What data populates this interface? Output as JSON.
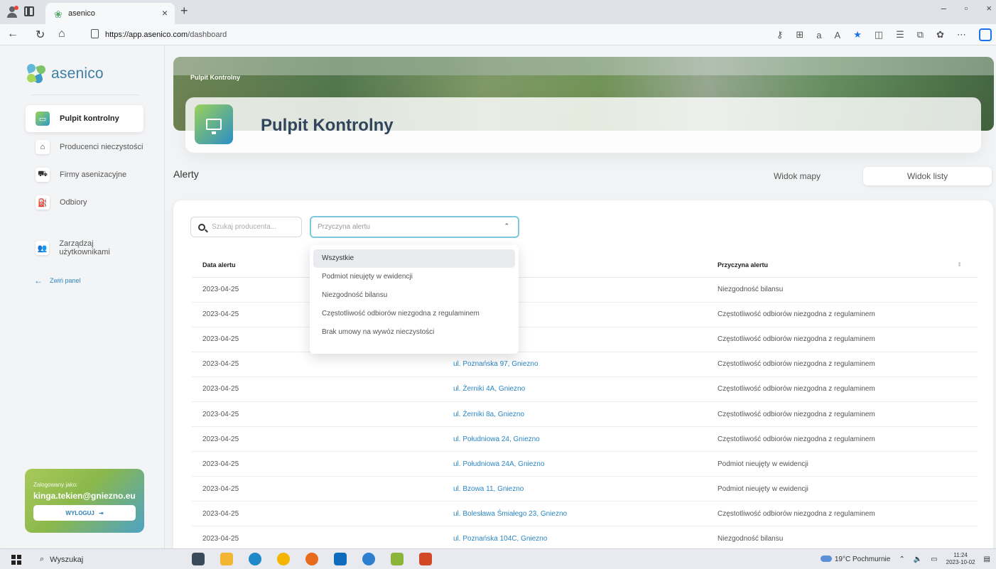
{
  "browser": {
    "tab_title": "asenico",
    "url_domain": "https://app.asenico.com",
    "url_path": "/dashboard"
  },
  "sidebar": {
    "brand": "asenico",
    "items": [
      {
        "label": "Pulpit kontrolny",
        "icon": "monitor-icon",
        "active": true
      },
      {
        "label": "Producenci nieczystości",
        "icon": "home-icon"
      },
      {
        "label": "Firmy asenizacyjne",
        "icon": "truck-icon"
      },
      {
        "label": "Odbiory",
        "icon": "tanker-icon"
      },
      {
        "label": "Zarządzaj użytkownikami",
        "icon": "users-icon"
      }
    ],
    "collapse_label": "Zwiń panel",
    "user": {
      "logged_label": "Zalogowany jako:",
      "email": "kinga.tekien@gniezno.eu",
      "logout_label": "WYLOGUJ"
    }
  },
  "header": {
    "breadcrumb": "Pulpit Kontrolny",
    "title": "Pulpit Kontrolny"
  },
  "alerts": {
    "section_title": "Alerty",
    "view_map": "Widok mapy",
    "view_list": "Widok listy",
    "search_placeholder": "Szukaj producenta...",
    "filter_placeholder": "Przyczyna alertu",
    "filter_options": [
      "Wszystkie",
      "Podmiot nieujęty w ewidencji",
      "Niezgodność bilansu",
      "Częstotliwość odbiorów niezgodna z regulaminem",
      "Brak umowy na wywóz nieczystości"
    ],
    "columns": [
      "Data alertu",
      "ości",
      "Przyczyna alertu"
    ],
    "rows": [
      {
        "date": "2023-04-25",
        "address": "zno",
        "reason": "Niezgodność bilansu"
      },
      {
        "date": "2023-04-25",
        "address": "iezno",
        "reason": "Częstotliwość odbiorów niezgodna z regulaminem"
      },
      {
        "date": "2023-04-25",
        "address": "A, Gniezno",
        "reason": "Częstotliwość odbiorów niezgodna z regulaminem"
      },
      {
        "date": "2023-04-25",
        "address": "ul. Poznańska 97, Gniezno",
        "reason": "Częstotliwość odbiorów niezgodna z regulaminem"
      },
      {
        "date": "2023-04-25",
        "address": "ul. Żerniki 4A, Gniezno",
        "reason": "Częstotliwość odbiorów niezgodna z regulaminem"
      },
      {
        "date": "2023-04-25",
        "address": "ul. Żerniki 8a, Gniezno",
        "reason": "Częstotliwość odbiorów niezgodna z regulaminem"
      },
      {
        "date": "2023-04-25",
        "address": "ul. Południowa 24, Gniezno",
        "reason": "Częstotliwość odbiorów niezgodna z regulaminem"
      },
      {
        "date": "2023-04-25",
        "address": "ul. Południowa 24A, Gniezno",
        "reason": "Podmiot nieujęty w ewidencji"
      },
      {
        "date": "2023-04-25",
        "address": "ul. Bzowa 11, Gniezno",
        "reason": "Podmiot nieujęty w ewidencji"
      },
      {
        "date": "2023-04-25",
        "address": "ul. Bolesława Śmiałego 23, Gniezno",
        "reason": "Częstotliwość odbiorów niezgodna z regulaminem"
      },
      {
        "date": "2023-04-25",
        "address": "ul. Poznańska 104C, Gniezno",
        "reason": "Niezgodność bilansu"
      }
    ]
  },
  "taskbar": {
    "search_label": "Wyszukaj",
    "weather": "19°C Pochmurnie",
    "time": "11:24",
    "date": "2023-10-02"
  },
  "colors": {
    "accent_blue": "#2b86c2",
    "accent_green": "#9bd15a",
    "select_border": "#7ec8de"
  }
}
